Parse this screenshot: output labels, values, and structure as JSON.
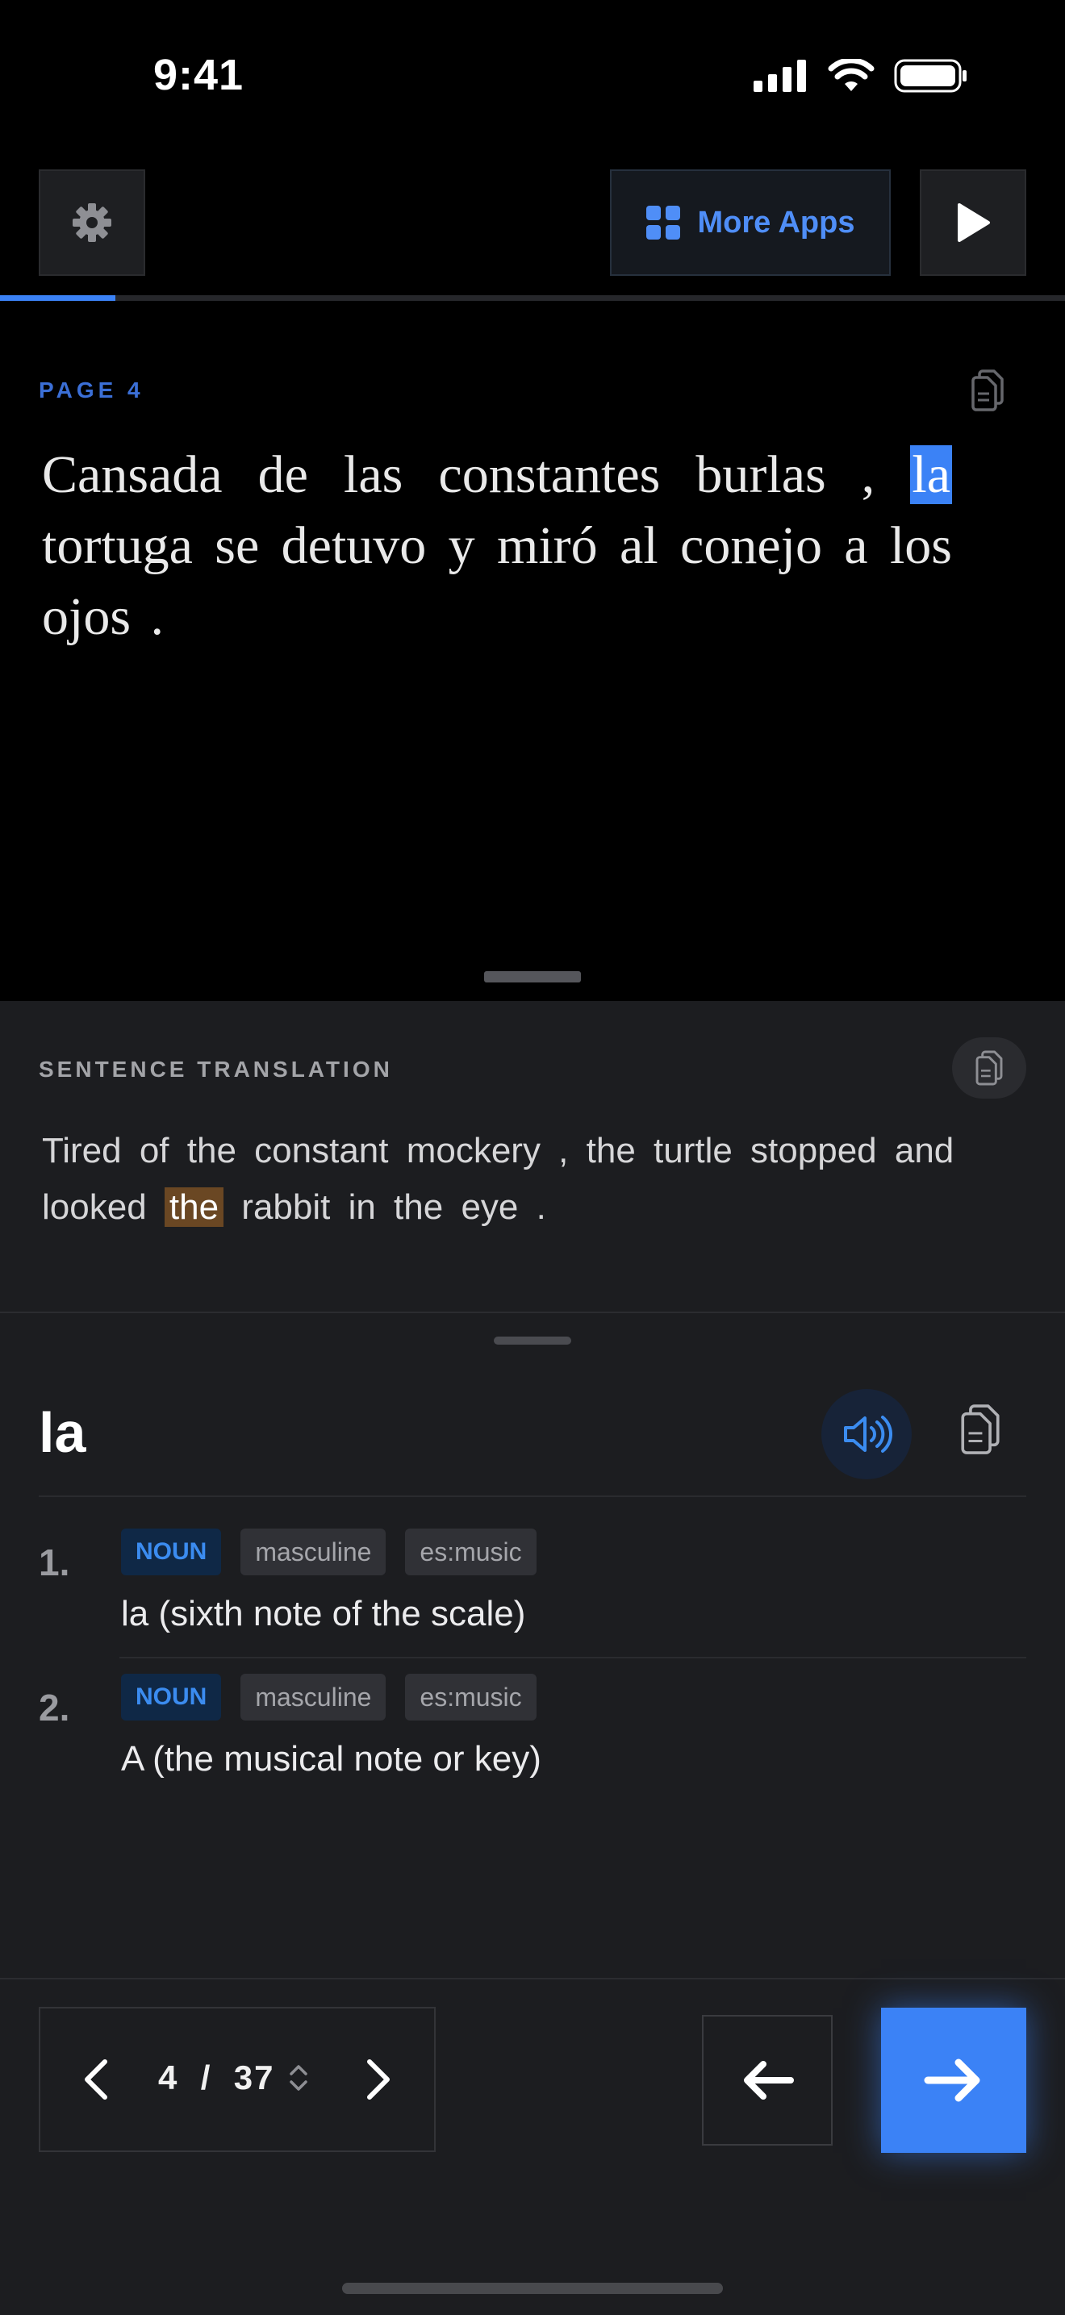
{
  "status": {
    "time": "9:41"
  },
  "toolbar": {
    "more_apps_label": "More Apps"
  },
  "progress": {
    "fraction": 0.108
  },
  "reading": {
    "page_label": "PAGE  4",
    "text_before": "Cansada de las constantes burlas , ",
    "highlight": "la",
    "text_after": " tortuga se detuvo y miró al conejo a los ojos ."
  },
  "translation": {
    "title": "SENTENCE TRANSLATION",
    "text_before": "Tired of the constant mockery , the turtle stopped and looked ",
    "highlight": "the",
    "text_after": " rabbit in the eye ."
  },
  "dictionary": {
    "word": "la",
    "definitions": [
      {
        "number": "1.",
        "pos": "NOUN",
        "gender": "masculine",
        "domain": "es:music",
        "text": "la (sixth note of the scale)"
      },
      {
        "number": "2.",
        "pos": "NOUN",
        "gender": "masculine",
        "domain": "es:music",
        "text": "A (the musical note or key)"
      }
    ]
  },
  "pager": {
    "current": "4",
    "separator": "/",
    "total": "37"
  },
  "colors": {
    "accent": "#3b82f6",
    "highlight_translation": "#6a4723",
    "background": "#000000",
    "panel": "#1c1d20"
  }
}
